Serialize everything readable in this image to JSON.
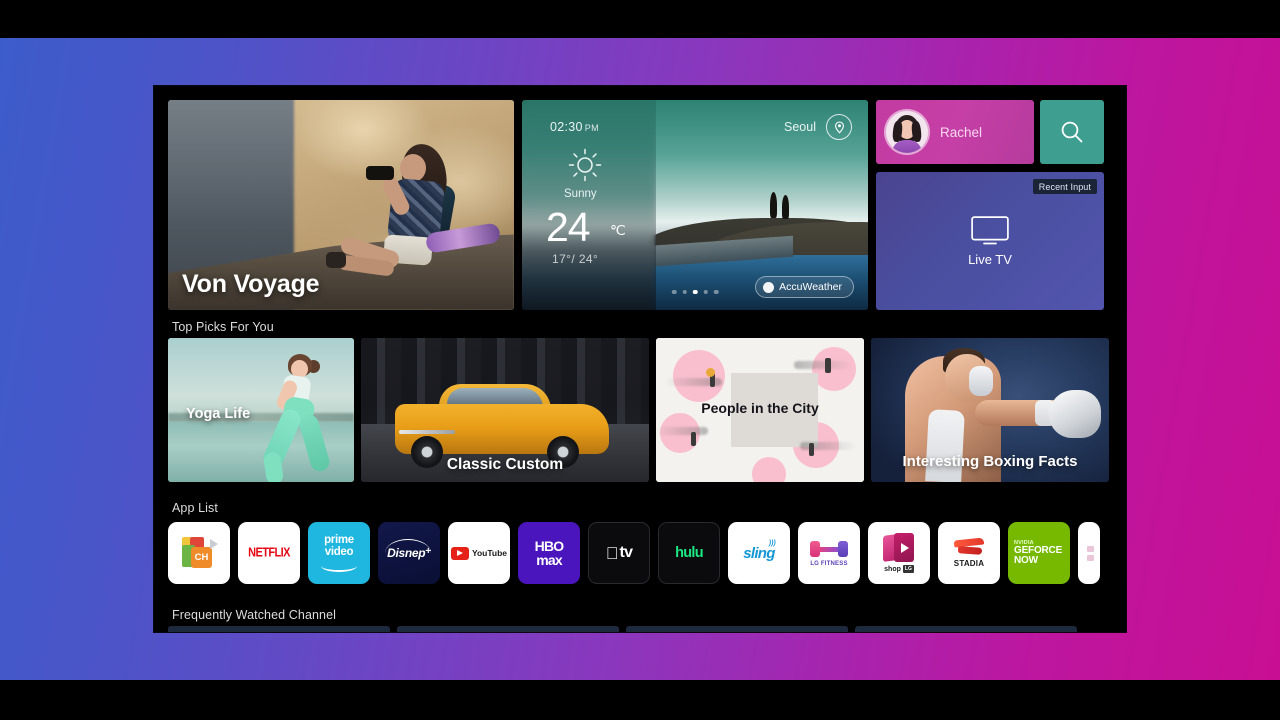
{
  "hero": {
    "title": "Von Voyage"
  },
  "weather": {
    "time": "02:30",
    "ampm": "PM",
    "city": "Seoul",
    "condition": "Sunny",
    "temperature": "24",
    "unit": "℃",
    "range": "17°/ 24°",
    "provider": "AccuWeather",
    "pagination_total": 5,
    "pagination_active": 3
  },
  "profile": {
    "name": "Rachel"
  },
  "search": {
    "icon": "search-icon"
  },
  "live_tv": {
    "badge": "Recent Input",
    "label": "Live TV"
  },
  "sections": {
    "top_picks": "Top Picks For You",
    "app_list": "App List",
    "frequently_watched": "Frequently Watched Channel"
  },
  "top_picks": [
    {
      "title": "Yoga Life"
    },
    {
      "title": "Classic Custom"
    },
    {
      "title": "People in the City"
    },
    {
      "title": "Interesting Boxing Facts"
    }
  ],
  "apps": [
    {
      "name": "CH",
      "label": "CH"
    },
    {
      "name": "Netflix",
      "label": "NETFLIX"
    },
    {
      "name": "Prime Video",
      "label_1": "prime",
      "label_2": "video"
    },
    {
      "name": "Disney+",
      "label": "Disnep",
      "plus": "+"
    },
    {
      "name": "YouTube",
      "label": "YouTube"
    },
    {
      "name": "HBO Max",
      "label_1": "HBO",
      "label_2": "max"
    },
    {
      "name": "Apple TV",
      "label": "tv"
    },
    {
      "name": "hulu",
      "label": "hulu"
    },
    {
      "name": "sling",
      "label": "sling"
    },
    {
      "name": "LG Fitness",
      "label_1": "LG",
      "label_2": "FITNESS"
    },
    {
      "name": "shop",
      "label": "shop",
      "badge": "LG"
    },
    {
      "name": "STADIA",
      "label": "STADIA"
    },
    {
      "name": "GeForce Now",
      "brand": "NVIDIA",
      "label_1": "GEFORCE",
      "label_2": "NOW"
    },
    {
      "name": "more",
      "label": ""
    }
  ],
  "colors": {
    "accent_magenta": "#c23ba1",
    "accent_teal": "#3e9e90",
    "live_tv": "#4a4fa0",
    "backdrop_left": "#3d5ccb",
    "backdrop_right": "#c80f93"
  }
}
